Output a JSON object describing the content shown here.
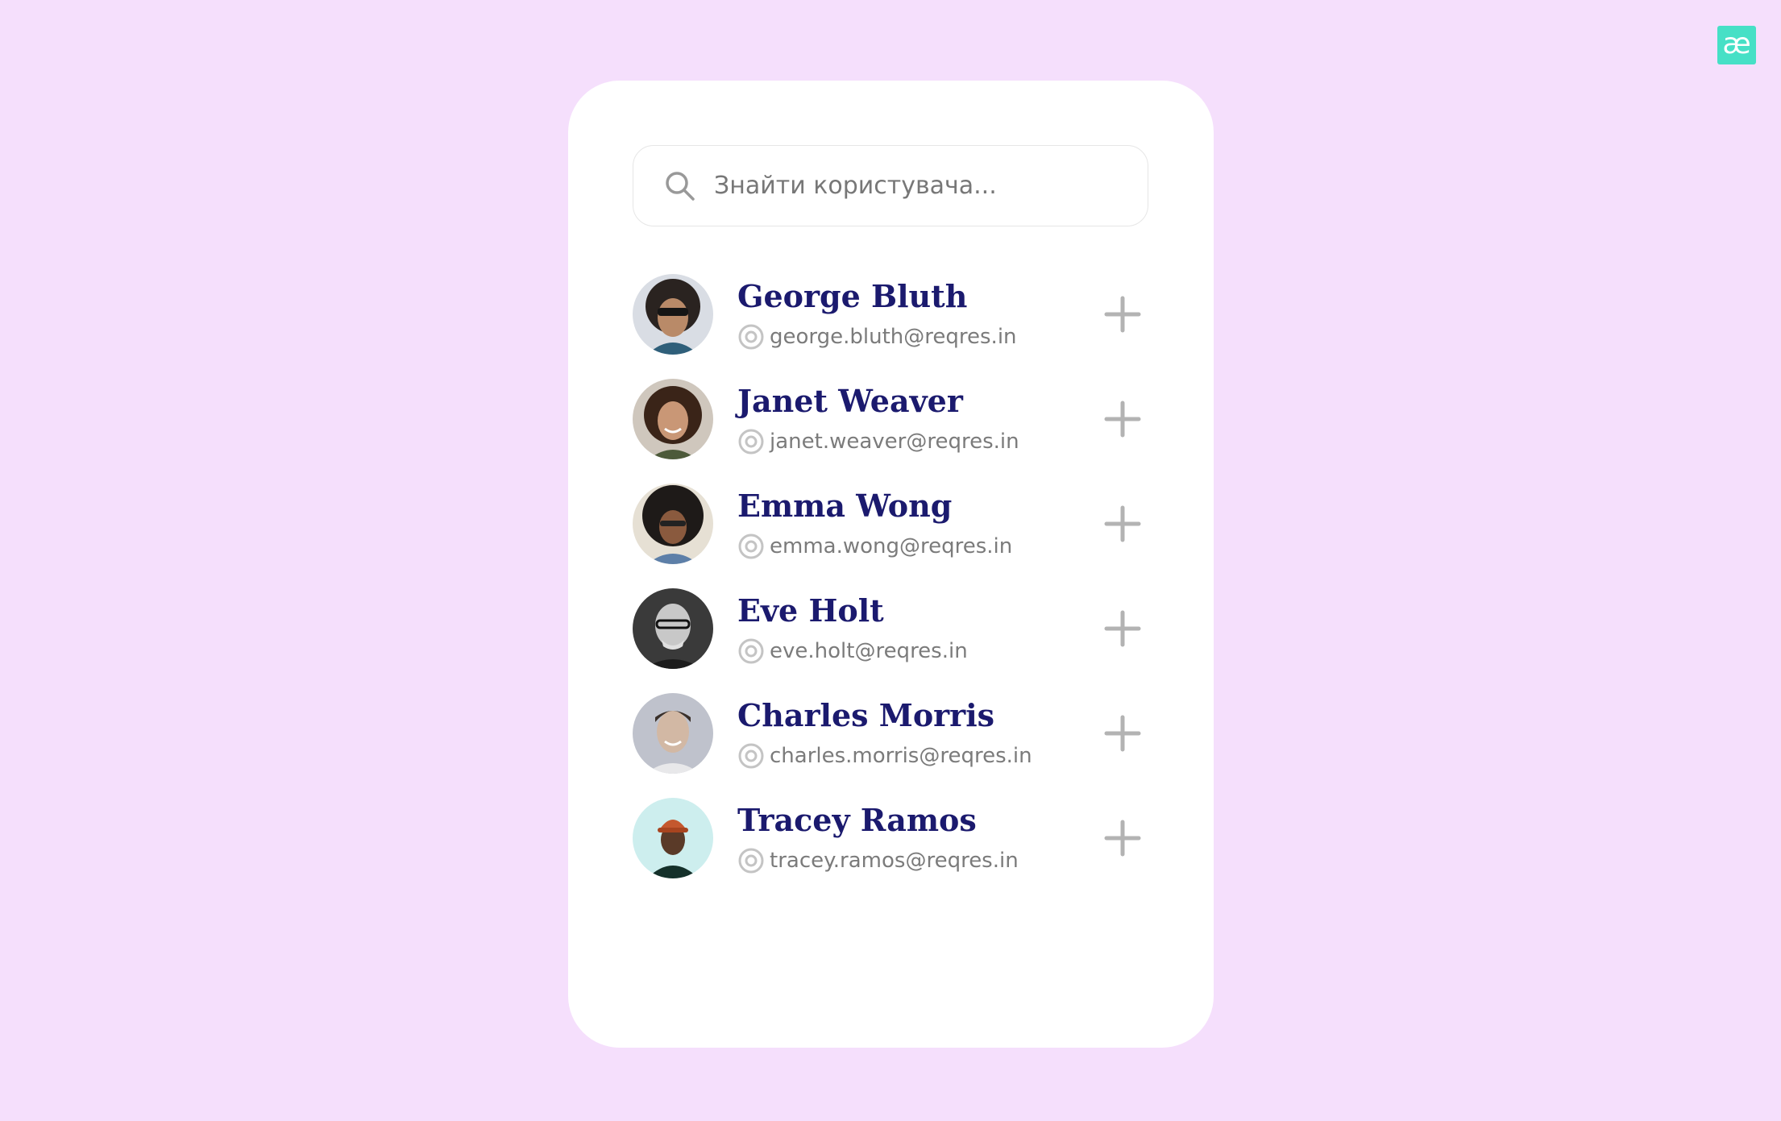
{
  "brand": {
    "logo_text": "æ",
    "logo_color": "#46e0c6"
  },
  "colors": {
    "background": "#f5dffc",
    "card": "#ffffff",
    "name": "#1b1a6e",
    "email": "#7b7b7b",
    "icon": "#b3b3b3"
  },
  "search": {
    "placeholder": "Знайти користувача...",
    "value": "",
    "icon": "search-icon"
  },
  "users": [
    {
      "name": "George Bluth",
      "email": "george.bluth@reqres.in",
      "avatar": "avatar-george",
      "action_icon": "plus-icon"
    },
    {
      "name": "Janet Weaver",
      "email": "janet.weaver@reqres.in",
      "avatar": "avatar-janet",
      "action_icon": "plus-icon"
    },
    {
      "name": "Emma Wong",
      "email": "emma.wong@reqres.in",
      "avatar": "avatar-emma",
      "action_icon": "plus-icon"
    },
    {
      "name": "Eve Holt",
      "email": "eve.holt@reqres.in",
      "avatar": "avatar-eve",
      "action_icon": "plus-icon"
    },
    {
      "name": "Charles Morris",
      "email": "charles.morris@reqres.in",
      "avatar": "avatar-charles",
      "action_icon": "plus-icon"
    },
    {
      "name": "Tracey Ramos",
      "email": "tracey.ramos@reqres.in",
      "avatar": "avatar-tracey",
      "action_icon": "plus-icon"
    }
  ]
}
